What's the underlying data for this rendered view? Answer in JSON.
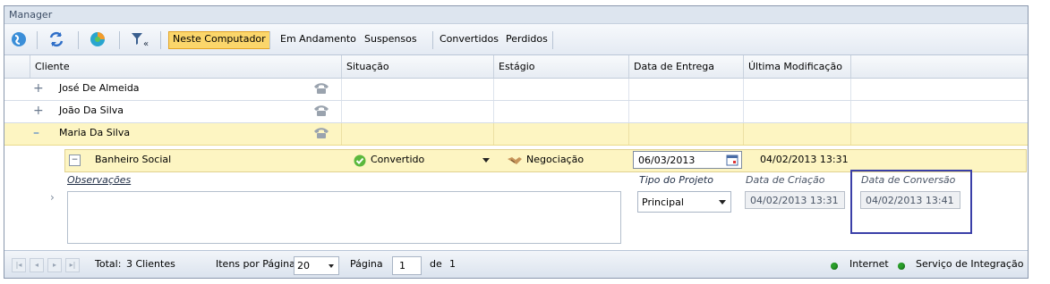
{
  "window": {
    "title": "Manager"
  },
  "toolbar": {
    "filters": {
      "local": "Neste Computador",
      "in_progress": "Em Andamento",
      "suspended": "Suspensos",
      "converted": "Convertidos",
      "lost": "Perdidos"
    }
  },
  "grid": {
    "headers": {
      "client": "Cliente",
      "status": "Situação",
      "stage": "Estágio",
      "delivery": "Data de Entrega",
      "modified": "Última Modificação"
    },
    "rows": [
      {
        "expander": "+",
        "client": "José De Almeida"
      },
      {
        "expander": "+",
        "client": "João Da Silva"
      },
      {
        "expander": "–",
        "client": "Maria Da Silva"
      }
    ],
    "child": {
      "expander": "⊟",
      "project": "Banheiro Social",
      "status": "Convertido",
      "stage": "Negociação",
      "delivery": "06/03/2013",
      "modified": "04/02/2013 13:31"
    },
    "detail": {
      "observations_label": "Observações",
      "observations_value": "",
      "project_type_label": "Tipo do Projeto",
      "project_type_value": "Principal",
      "created_label": "Data de Criação",
      "created_value": "04/02/2013 13:31",
      "converted_label": "Data de Conversão",
      "converted_value": "04/02/2013 13:41"
    }
  },
  "footer": {
    "total_label": "Total:",
    "total_value": "3 Clientes",
    "per_page_label": "Itens por Página:",
    "per_page_value": "20",
    "page_label": "Página",
    "page_value": "1",
    "of_label": "de",
    "of_value": "1",
    "internet": "Internet",
    "integration": "Serviço de Integração",
    "status_color": "#2aa02a"
  },
  "colors": {
    "selected_row": "#fdf5c2",
    "active_filter": "#fbd66b",
    "highlight_box": "#3a3fa8"
  }
}
